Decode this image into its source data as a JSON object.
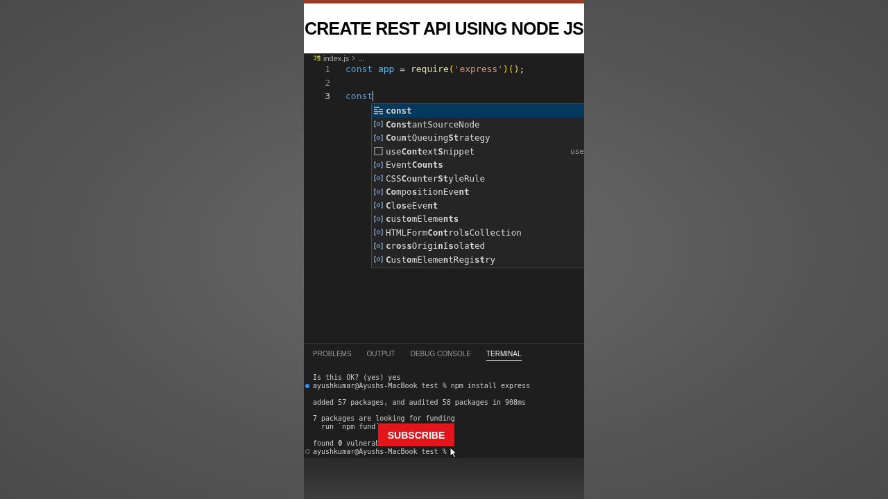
{
  "title": "CREATE REST API USING NODE JS",
  "breadcrumb": {
    "file": "index.js",
    "rest": "..."
  },
  "code_lines": [
    {
      "number": "1",
      "kind": "statement",
      "text": "const app = require('express')();"
    },
    {
      "number": "2",
      "kind": "empty"
    },
    {
      "number": "3",
      "kind": "typing",
      "text": "const"
    }
  ],
  "suggestions": [
    {
      "kind": "keyword",
      "label": "**const**",
      "selected": true
    },
    {
      "kind": "variable",
      "label": "**Const**antSourceNode",
      "selected": false
    },
    {
      "kind": "variable",
      "label": "**Co**u**n**tQueuing**St**rategy",
      "selected": false
    },
    {
      "kind": "snippet",
      "label": "use**Cont**ext**S**nippet",
      "detail": "use",
      "selected": false
    },
    {
      "kind": "variable",
      "label": "Event**Counts**",
      "selected": false
    },
    {
      "kind": "variable",
      "label": "CSS**C**o**u**n**t**er**St**yleRule",
      "selected": false
    },
    {
      "kind": "variable",
      "label": "**Co**mpo**s**itionEve**nt**",
      "selected": false
    },
    {
      "kind": "variable",
      "label": "**C**l**os**eEve**nt**",
      "selected": false
    },
    {
      "kind": "variable",
      "label": "**c**ust**o**mEleme**nts**",
      "selected": false
    },
    {
      "kind": "variable",
      "label": "HTMLForm**Cont**rol**s**Collection",
      "selected": false
    },
    {
      "kind": "variable",
      "label": "**c**r**o**s**s**Origi**n**I**s**ola**t**ed",
      "selected": false
    },
    {
      "kind": "variable",
      "label": "**C**ust**o**mEleme**n**tRegi**st**ry",
      "selected": false
    }
  ],
  "panel_tabs": [
    {
      "label": "PROBLEMS",
      "selected": false
    },
    {
      "label": "OUTPUT",
      "selected": false
    },
    {
      "label": "DEBUG CONSOLE",
      "selected": false
    },
    {
      "label": "TERMINAL",
      "selected": true
    }
  ],
  "terminal_lines": [
    {
      "kind": "output",
      "text": "Is this OK? (yes) yes"
    },
    {
      "kind": "command_done",
      "text": "ayushkumar@Ayushs-MacBook test % npm install express"
    },
    {
      "kind": "blank"
    },
    {
      "kind": "output",
      "text": "added 57 packages, and audited 58 packages in 908ms"
    },
    {
      "kind": "blank"
    },
    {
      "kind": "output",
      "text": "7 packages are looking for funding"
    },
    {
      "kind": "output",
      "text": "  run `npm fund`"
    },
    {
      "kind": "blank"
    },
    {
      "kind": "output",
      "text": "found **0** vulnerab"
    },
    {
      "kind": "prompt",
      "text": "ayushkumar@Ayushs-MacBook test %"
    }
  ],
  "subscribe_button": "SUBSCRIBE"
}
